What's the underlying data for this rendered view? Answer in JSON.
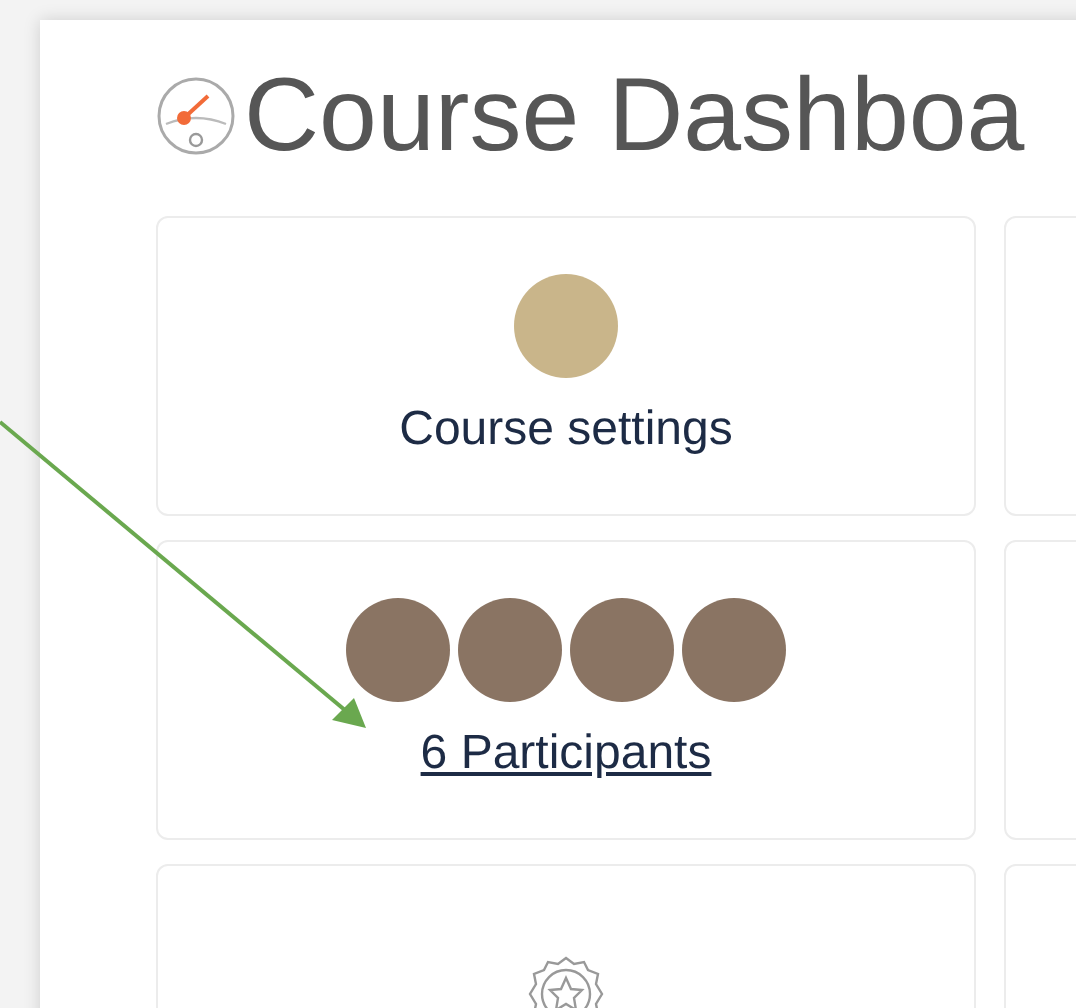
{
  "page": {
    "title": "Course Dashboa"
  },
  "cards": [
    {
      "kind": "image",
      "label": "Course settings"
    },
    {
      "kind": "avatars",
      "label": "6 Participants"
    },
    {
      "kind": "badge"
    }
  ]
}
